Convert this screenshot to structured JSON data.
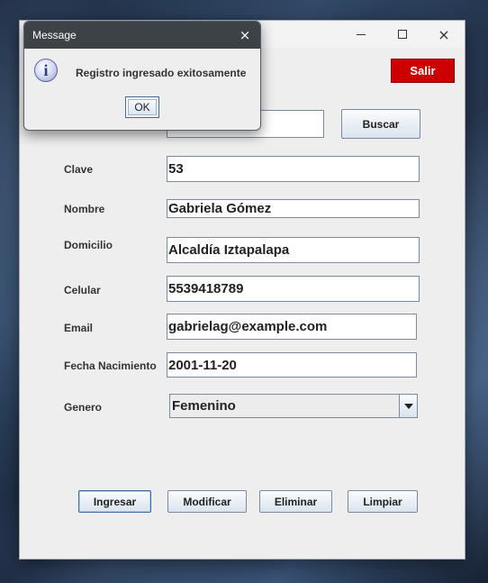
{
  "window": {
    "title": "",
    "controls": {
      "minimize": "minimize-icon",
      "maximize": "maximize-icon",
      "close": "×"
    },
    "salir_label": "Salir",
    "salir_color": "#cc0000"
  },
  "form": {
    "search_value": "",
    "buscar_label": "Buscar",
    "fields": [
      {
        "label": "Clave",
        "value": "53"
      },
      {
        "label": "Nombre",
        "value": "Gabriela Gómez"
      },
      {
        "label": "Domicilio",
        "value": "Alcaldía Iztapalapa"
      },
      {
        "label": "Celular",
        "value": "5539418789"
      },
      {
        "label": "Email",
        "value": "gabrielag@example.com"
      },
      {
        "label": "Fecha Nacimiento",
        "value": "2001-11-20"
      }
    ],
    "genero": {
      "label": "Genero",
      "selected": "Femenino"
    }
  },
  "actions": {
    "ingresar": "Ingresar",
    "modificar": "Modificar",
    "eliminar": "Eliminar",
    "limpiar": "Limpiar"
  },
  "dialog": {
    "title": "Message",
    "close": "×",
    "icon": "info-icon",
    "icon_glyph": "i",
    "message": "Registro ingresado exitosamente",
    "ok_label": "OK"
  }
}
